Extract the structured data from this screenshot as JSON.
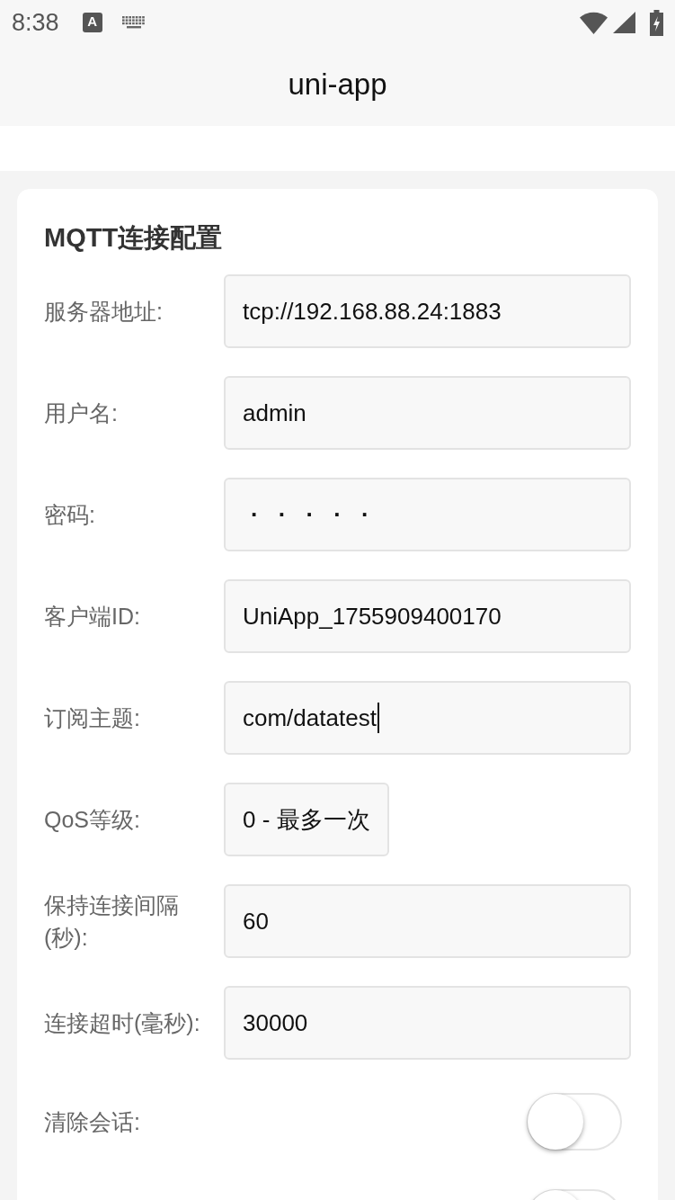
{
  "status_bar": {
    "time": "8:38",
    "notifications": [
      {
        "kind": "app",
        "glyph": "A"
      },
      {
        "kind": "keyboard"
      }
    ]
  },
  "nav_bar": {
    "title": "uni-app"
  },
  "card": {
    "title": "MQTT连接配置",
    "fields": [
      {
        "kind": "text",
        "label": "服务器地址:",
        "value": "tcp://192.168.88.24:1883",
        "focused": false
      },
      {
        "kind": "text",
        "label": "用户名:",
        "value": "admin",
        "focused": false
      },
      {
        "kind": "password",
        "label": "密码:",
        "value": "·····",
        "focused": false
      },
      {
        "kind": "text",
        "label": "客户端ID:",
        "value": "UniApp_1755909400170",
        "focused": false
      },
      {
        "kind": "text",
        "label": "订阅主题:",
        "value": "com/datatest",
        "focused": true
      },
      {
        "kind": "picker",
        "label": "QoS等级:",
        "value": "0 - 最多一次"
      },
      {
        "kind": "text",
        "label": "保持连接间隔(秒):",
        "value": "60",
        "focused": false
      },
      {
        "kind": "text",
        "label": "连接超时(毫秒):",
        "value": "30000",
        "focused": false
      },
      {
        "kind": "switch",
        "label": "清除会话:",
        "on": false
      },
      {
        "kind": "switch",
        "on": false
      }
    ]
  }
}
